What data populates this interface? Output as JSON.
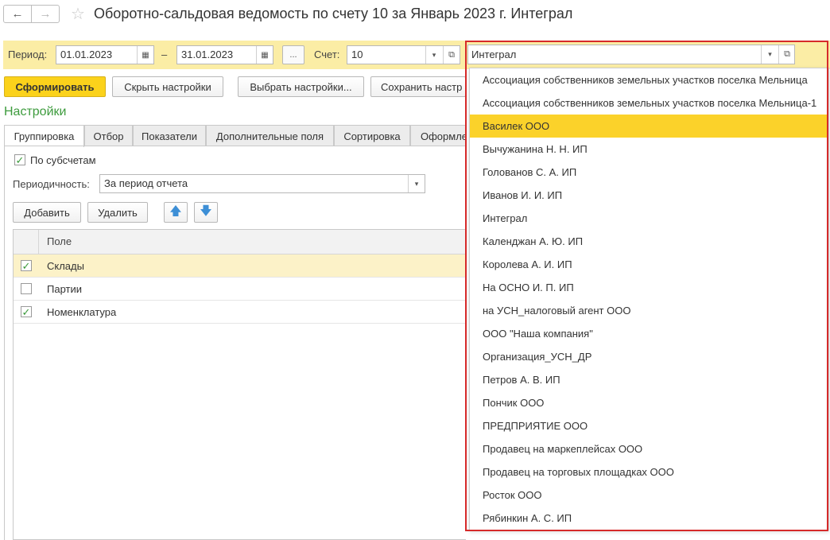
{
  "window": {
    "title": "Оборотно-сальдовая ведомость по счету 10 за Январь 2023 г. Интеграл"
  },
  "nav": {
    "back_icon": "←",
    "forward_icon": "→",
    "star_icon": "☆"
  },
  "params": {
    "period_label": "Период:",
    "date_from": "01.01.2023",
    "dash": "–",
    "date_to": "31.01.2023",
    "ellipsis": "...",
    "account_label": "Счет:",
    "account_value": "10",
    "org_value": "Интеграл"
  },
  "buttons": {
    "generate": "Сформировать",
    "hide_settings": "Скрыть настройки",
    "choose_settings": "Выбрать настройки...",
    "save_settings": "Сохранить настр"
  },
  "settings": {
    "title": "Настройки",
    "tabs": [
      "Группировка",
      "Отбор",
      "Показатели",
      "Дополнительные поля",
      "Сортировка",
      "Оформле"
    ],
    "by_subaccounts_label": "По субсчетам",
    "periodicity_label": "Периодичность:",
    "periodicity_value": "За период отчета",
    "add": "Добавить",
    "delete": "Удалить",
    "grid_header": "Поле",
    "rows": [
      {
        "label": "Склады",
        "checked": true
      },
      {
        "label": "Партии",
        "checked": false
      },
      {
        "label": "Номенклатура",
        "checked": true
      }
    ]
  },
  "dropdown": {
    "items": [
      "Ассоциация собственников земельных участков поселка Мельница",
      "Ассоциация собственников земельных участков поселка Мельница-1",
      "Василек ООО",
      "Вычужанина Н. Н. ИП",
      "Голованов С. А. ИП",
      "Иванов И. И. ИП",
      "Интеграл",
      "Календжан А. Ю. ИП",
      "Королева А. И. ИП",
      "На ОСНО И. П. ИП",
      "на УСН_налоговый агент ООО",
      "ООО \"Наша компания\"",
      "Организация_УСН_ДР",
      "Петров А. В. ИП",
      "Пончик ООО",
      "ПРЕДПРИЯТИЕ ООО",
      "Продавец на маркеплейсах ООО",
      "Продавец на торговых площадках ООО",
      "Росток ООО",
      "Рябинкин А. С. ИП"
    ],
    "highlighted_index": 2
  },
  "colors": {
    "accent_yellow": "#fbd21b",
    "param_bar": "#fbeda5",
    "highlight": "#fbd22a",
    "red_frame": "#d62a2a",
    "settings_green": "#3d9b3d"
  }
}
